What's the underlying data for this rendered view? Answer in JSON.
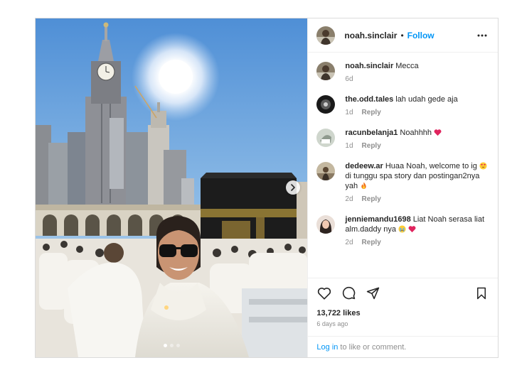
{
  "post": {
    "author": {
      "username": "noah.sinclair",
      "separator": "•",
      "follow_label": "Follow",
      "avatar": "avatar-noah"
    },
    "caption": {
      "username": "noah.sinclair",
      "text": "Mecca",
      "time": "6d"
    },
    "carousel": {
      "slide_count": 3,
      "current_slide": 1
    },
    "comments": [
      {
        "username": "the.odd.tales",
        "text": "lah udah gede aja",
        "time": "1d",
        "reply_label": "Reply"
      },
      {
        "username": "racunbelanja1",
        "text": "Noahhhh",
        "emoji": "red-heart",
        "time": "1d",
        "reply_label": "Reply"
      },
      {
        "username": "dedeew.ar",
        "text_start": "Huaa Noah, welcome to ig",
        "emoji_1": "heart-eyes",
        "text_end": "di tunggu spa story dan postingan2nya yah",
        "emoji_2": "fire",
        "time": "2d",
        "reply_label": "Reply"
      },
      {
        "username": "jenniemandu1698",
        "text": "Liat Noah serasa liat alm.daddy nya",
        "emoji_1": "crying-face",
        "emoji_2": "red-heart",
        "time": "2d",
        "reply_label": "Reply"
      }
    ],
    "likes": "13,722 likes",
    "posted_ago": "6 days ago",
    "login_prompt": {
      "link": "Log in",
      "text": "to like or comment."
    },
    "colors": {
      "link_blue": "#0095f6",
      "muted": "#8e8e8e",
      "text": "#262626",
      "border": "#dbdbdb",
      "heart_red": "#ed4956"
    }
  }
}
